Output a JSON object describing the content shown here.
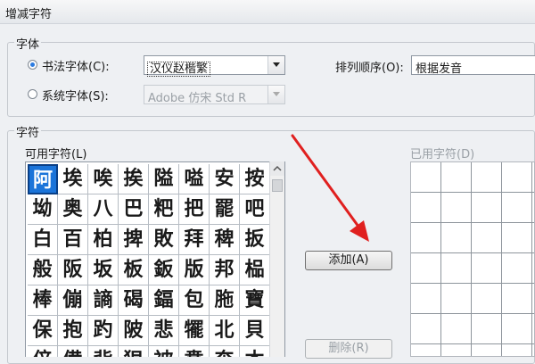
{
  "window": {
    "title": "增减字符"
  },
  "font_group": {
    "legend": "字体",
    "calligraphy_radio": {
      "label": "书法字体(C):",
      "checked": true
    },
    "calligraphy_select": {
      "value": "汉仪赵楷繁"
    },
    "system_radio": {
      "label": "系统字体(S):",
      "checked": false
    },
    "system_select": {
      "value": "Adobe 仿宋 Std R"
    },
    "sort_label": "排列顺序(O):",
    "sort_select": {
      "value": "根据发音"
    }
  },
  "char_group": {
    "legend": "字符",
    "available_label": "可用字符(L)",
    "available_chars": [
      [
        "阿",
        "埃",
        "唉",
        "挨",
        "隘",
        "嗌",
        "安",
        "按"
      ],
      [
        "坳",
        "奥",
        "八",
        "巴",
        "粑",
        "把",
        "罷",
        "吧"
      ],
      [
        "白",
        "百",
        "柏",
        "捭",
        "敗",
        "拜",
        "稗",
        "扳"
      ],
      [
        "般",
        "阪",
        "坂",
        "板",
        "鈑",
        "版",
        "邦",
        "榀"
      ],
      [
        "棒",
        "傰",
        "謪",
        "碣",
        "鍢",
        "包",
        "胣",
        "寶"
      ],
      [
        "保",
        "抱",
        "趵",
        "陂",
        "悲",
        "犤",
        "北",
        "貝"
      ],
      [
        "倍",
        "備",
        "背",
        "狽",
        "被",
        "賁",
        "奔",
        "本"
      ]
    ],
    "used_label": "已用字符(D)",
    "add_button": "添加(A)",
    "delete_button": "删除(R)"
  },
  "colors": {
    "selection": "#1b74d9",
    "arrow": "#e0201f"
  }
}
